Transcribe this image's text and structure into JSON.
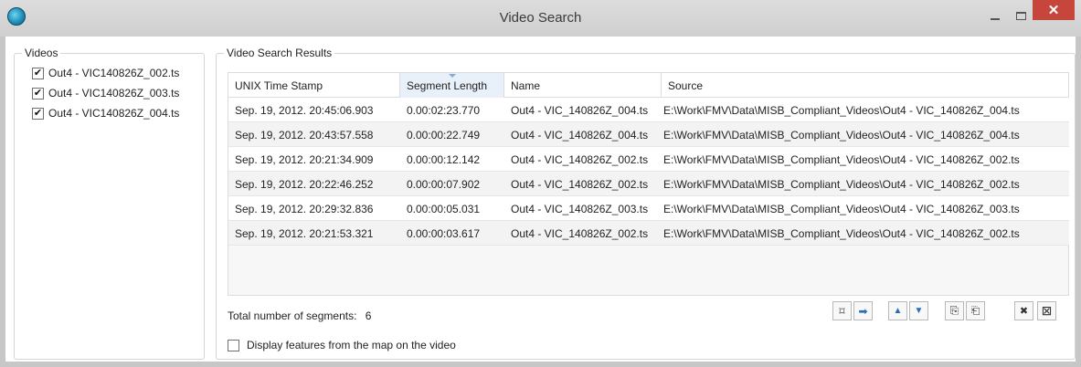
{
  "window": {
    "title": "Video Search",
    "close_glyph": "✕",
    "icons": {
      "app": "globe-icon"
    }
  },
  "videos": {
    "label": "Videos",
    "items": [
      {
        "label": "Out4 - VIC140826Z_002.ts",
        "checked": true
      },
      {
        "label": "Out4 - VIC140826Z_003.ts",
        "checked": true
      },
      {
        "label": "Out4 - VIC140826Z_004.ts",
        "checked": true
      }
    ]
  },
  "results": {
    "label": "Video Search Results",
    "columns": [
      "UNIX Time Stamp",
      "Segment Length",
      "Name",
      "Source"
    ],
    "sorted_column": "Segment Length",
    "rows": [
      [
        "Sep. 19, 2012. 20:45:06.903",
        "0.00:02:23.770",
        "Out4 - VIC_140826Z_004.ts",
        "E:\\Work\\FMV\\Data\\MISB_Compliant_Videos\\Out4 - VIC_140826Z_004.ts"
      ],
      [
        "Sep. 19, 2012. 20:43:57.558",
        "0.00:00:22.749",
        "Out4 - VIC_140826Z_004.ts",
        "E:\\Work\\FMV\\Data\\MISB_Compliant_Videos\\Out4 - VIC_140826Z_004.ts"
      ],
      [
        "Sep. 19, 2012. 20:21:34.909",
        "0.00:00:12.142",
        "Out4 - VIC_140826Z_002.ts",
        "E:\\Work\\FMV\\Data\\MISB_Compliant_Videos\\Out4 - VIC_140826Z_002.ts"
      ],
      [
        "Sep. 19, 2012. 20:22:46.252",
        "0.00:00:07.902",
        "Out4 - VIC_140826Z_002.ts",
        "E:\\Work\\FMV\\Data\\MISB_Compliant_Videos\\Out4 - VIC_140826Z_002.ts"
      ],
      [
        "Sep. 19, 2012. 20:29:32.836",
        "0.00:00:05.031",
        "Out4 - VIC_140826Z_003.ts",
        "E:\\Work\\FMV\\Data\\MISB_Compliant_Videos\\Out4 - VIC_140826Z_003.ts"
      ],
      [
        "Sep. 19, 2012. 20:21:53.321",
        "0.00:00:03.617",
        "Out4 - VIC_140826Z_002.ts",
        "E:\\Work\\FMV\\Data\\MISB_Compliant_Videos\\Out4 - VIC_140826Z_002.ts"
      ]
    ],
    "total_label": "Total number of segments:",
    "total_count": "6",
    "display_features_label": "Display features from the map on the video",
    "display_features_checked": false
  },
  "toolbar": {
    "buttons": [
      {
        "name": "zoom-to-extent-icon",
        "glyph": "⌑"
      },
      {
        "name": "export-icon",
        "glyph": "➡"
      },
      {
        "name": "move-up-icon",
        "glyph": "▲"
      },
      {
        "name": "move-down-icon",
        "glyph": "▼"
      },
      {
        "name": "copy-icon",
        "glyph": "⎘"
      },
      {
        "name": "paste-icon",
        "glyph": "⎗"
      },
      {
        "name": "delete-icon",
        "glyph": "✖"
      },
      {
        "name": "clear-all-icon",
        "glyph": "⊠"
      }
    ]
  }
}
